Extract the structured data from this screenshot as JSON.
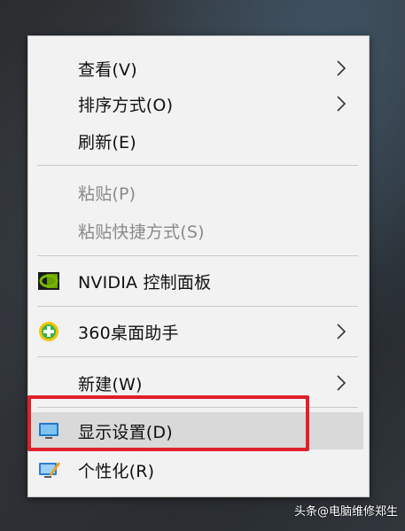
{
  "menu": {
    "items": [
      {
        "label": "查看(V)",
        "has_submenu": true,
        "enabled": true
      },
      {
        "label": "排序方式(O)",
        "has_submenu": true,
        "enabled": true
      },
      {
        "label": "刷新(E)",
        "has_submenu": false,
        "enabled": true
      },
      {
        "label": "粘贴(P)",
        "has_submenu": false,
        "enabled": false
      },
      {
        "label": "粘贴快捷方式(S)",
        "has_submenu": false,
        "enabled": false
      },
      {
        "label": "NVIDIA 控制面板",
        "has_submenu": false,
        "enabled": true,
        "icon": "nvidia-icon"
      },
      {
        "label": "360桌面助手",
        "has_submenu": true,
        "enabled": true,
        "icon": "360-icon"
      },
      {
        "label": "新建(W)",
        "has_submenu": true,
        "enabled": true
      },
      {
        "label": "显示设置(D)",
        "has_submenu": false,
        "enabled": true,
        "icon": "display-settings-icon",
        "highlighted": true
      },
      {
        "label": "个性化(R)",
        "has_submenu": false,
        "enabled": true,
        "icon": "personalize-icon"
      }
    ]
  },
  "watermark": "头条@电脑维修郑生",
  "colors": {
    "highlight_box": "#e0202a",
    "hover_bg": "#d9d9d9",
    "nvidia_green": "#76b900"
  }
}
